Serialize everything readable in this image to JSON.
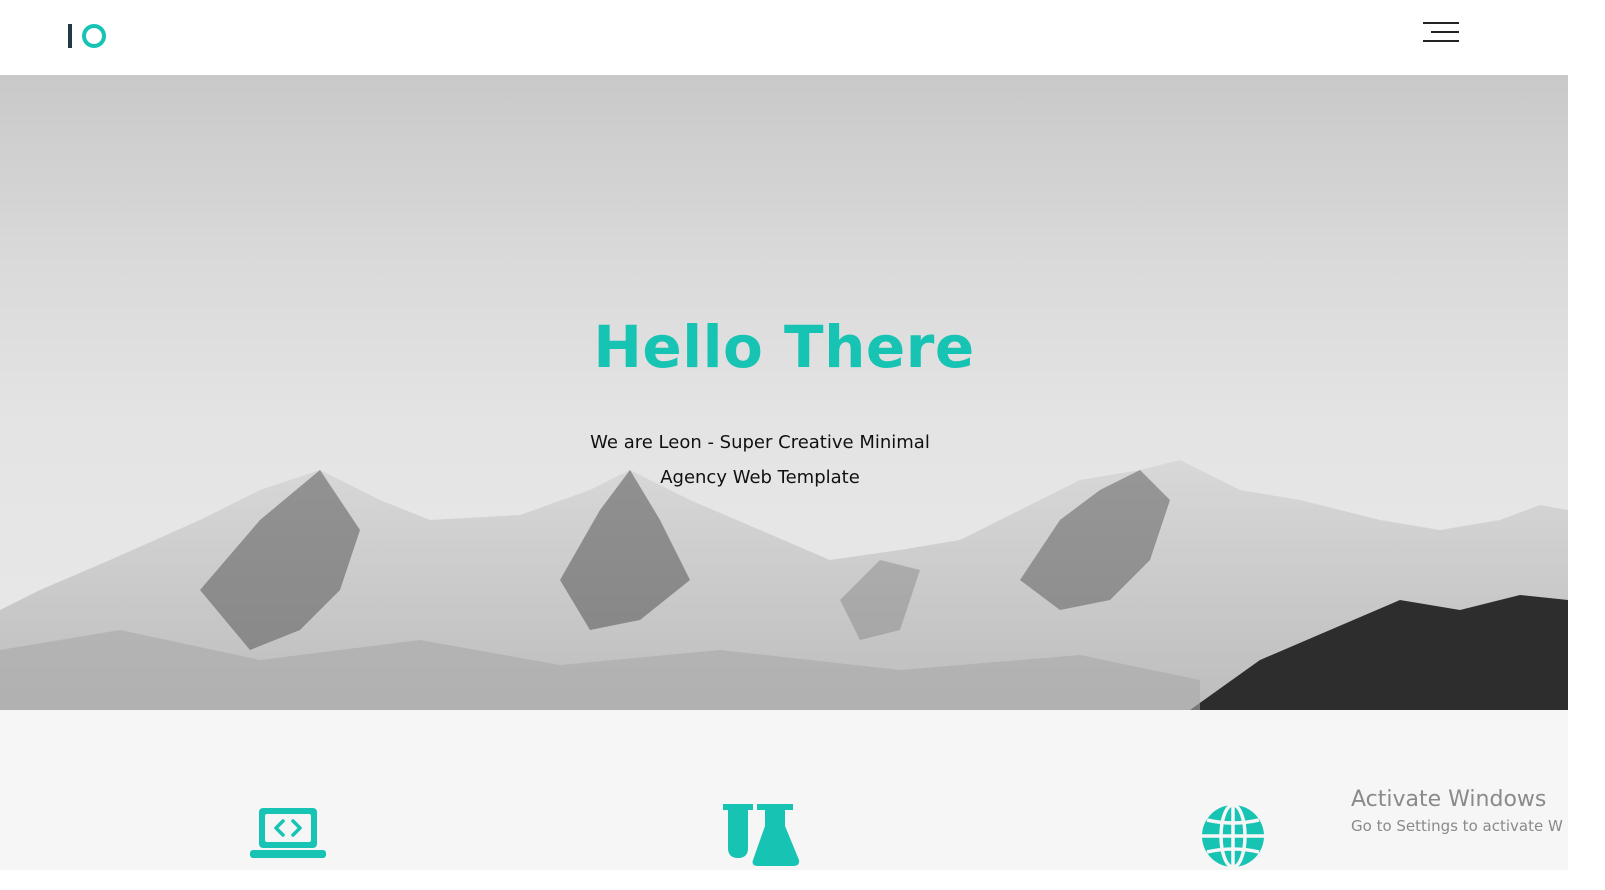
{
  "header": {
    "logo": {
      "bar_color": "#1f3a44",
      "ring_color": "#17c3b2"
    },
    "menu_icon": "hamburger-menu-icon"
  },
  "hero": {
    "title": "Hello There",
    "subtitle_line1": "We are Leon - Super Creative Minimal",
    "subtitle_line2": "Agency Web Template",
    "accent_color": "#17c3b2"
  },
  "services": {
    "icons": [
      "laptop-code-icon",
      "flask-icon",
      "globe-icon"
    ],
    "icon_color": "#17c3b2"
  },
  "watermark": {
    "title": "Activate Windows",
    "subtitle": "Go to Settings to activate W"
  }
}
